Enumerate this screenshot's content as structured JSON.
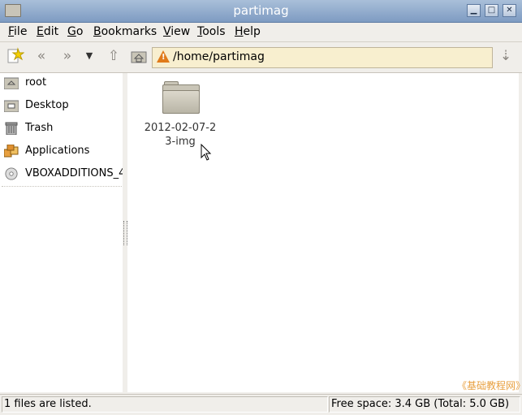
{
  "window": {
    "title": "partimag"
  },
  "menu": [
    {
      "label": "File",
      "mnemonic": "F"
    },
    {
      "label": "Edit",
      "mnemonic": "E"
    },
    {
      "label": "Go",
      "mnemonic": "G"
    },
    {
      "label": "Bookmarks",
      "mnemonic": "B"
    },
    {
      "label": "View",
      "mnemonic": "V"
    },
    {
      "label": "Tools",
      "mnemonic": "T"
    },
    {
      "label": "Help",
      "mnemonic": "H"
    }
  ],
  "location": {
    "path": "/home/partimag"
  },
  "sidebar": {
    "items": [
      {
        "label": "root",
        "icon": "home-folder-icon"
      },
      {
        "label": "Desktop",
        "icon": "desktop-folder-icon"
      },
      {
        "label": "Trash",
        "icon": "trash-icon"
      },
      {
        "label": "Applications",
        "icon": "applications-icon"
      },
      {
        "label": "VBOXADDITIONS_4",
        "icon": "cd-icon"
      }
    ]
  },
  "files": [
    {
      "name_line1": "2012-02-07-2",
      "name_line2": "3-img",
      "icon": "folder-icon"
    }
  ],
  "watermark": "《基础教程网》",
  "status": {
    "left": "1 files are listed.",
    "right": "Free space: 3.4 GB (Total: 5.0 GB)"
  }
}
